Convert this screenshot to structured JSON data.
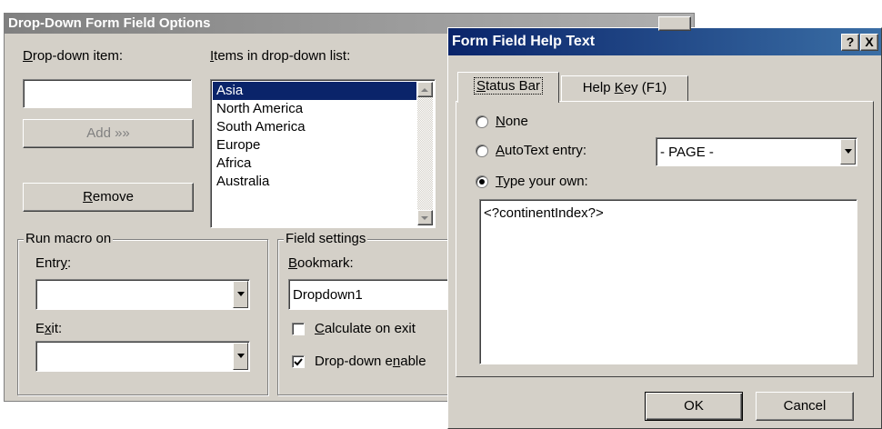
{
  "dropdown_dialog": {
    "title": "Drop-Down Form Field Options",
    "dropdown_item_label_u": "D",
    "dropdown_item_label_rest": "rop-down item:",
    "dropdown_item_value": "",
    "items_label_u": "I",
    "items_label_rest": "tems in drop-down list:",
    "items": [
      "Asia",
      "North America",
      "South America",
      "Europe",
      "Africa",
      "Australia"
    ],
    "selected_item": "Asia",
    "add_button": "Add »»",
    "remove_button_u": "R",
    "remove_button_rest": "emove",
    "run_macro_legend": "Run macro on",
    "entry_label_pre": "Entr",
    "entry_label_u": "y",
    "entry_label_post": ":",
    "entry_value": "",
    "exit_label_pre": "E",
    "exit_label_u": "x",
    "exit_label_post": "it:",
    "exit_value": "",
    "field_settings_legend": "Field settings",
    "bookmark_label_u": "B",
    "bookmark_label_rest": "ookmark:",
    "bookmark_value": "Dropdown1",
    "calculate_label_u": "C",
    "calculate_label_rest": "alculate on exit",
    "calculate_checked": false,
    "enabled_label_pre": "Drop-down e",
    "enabled_label_u": "n",
    "enabled_label_post": "able",
    "enabled_checked": true
  },
  "help_dialog": {
    "title": "Form Field Help Text",
    "help_btn": "?",
    "close_btn": "X",
    "tabs": {
      "status_bar_u": "S",
      "status_bar_rest": "tatus Bar",
      "help_key_pre": "Help ",
      "help_key_u": "K",
      "help_key_post": "ey (F1)"
    },
    "none_u": "N",
    "none_rest": "one",
    "autotext_u": "A",
    "autotext_rest": "utoText entry:",
    "autotext_value": "- PAGE -",
    "type_own_u": "T",
    "type_own_rest": "ype your own:",
    "selected_option": "type_your_own",
    "text_value": "<?continentIndex?>",
    "ok_button": "OK",
    "cancel_button": "Cancel"
  },
  "colors": {
    "title_bar": "#0a246a",
    "title_bar_inactive": "#808080",
    "face": "#d4d0c8",
    "selection": "#0a246a"
  }
}
